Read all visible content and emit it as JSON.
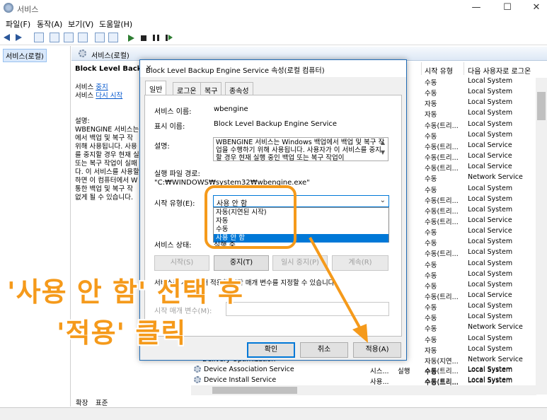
{
  "window": {
    "title": "서비스",
    "minimize": "—",
    "maximize": "☐",
    "close": "✕"
  },
  "menu": [
    "파일(F)",
    "동작(A)",
    "보기(V)",
    "도움말(H)"
  ],
  "left_pane": {
    "item": "서비스(로컬)"
  },
  "content_header": "서비스(로컬)",
  "description": {
    "title": "Block Level Backup",
    "stop_prefix": "서비스 ",
    "stop_link": "중지",
    "restart_prefix": "서비스 ",
    "restart_link": "다시 시작",
    "label": "설명:",
    "lines": [
      "WBENGINE 서비스는 W",
      "에서 백업 및 복구 작",
      "위해 사용됩니다. 사용",
      "를 중지할 경우 현재 실",
      "또는 복구 작업이 실패",
      "다. 이 서비스를 사용할",
      "하면 이 컴퓨터에서 W",
      "통한 백업 및 복구 작",
      "없게 될 수 있습니다."
    ]
  },
  "columns": {
    "startup": "시작 유형",
    "logon": "다음 사용자로 로그온"
  },
  "rows": [
    {
      "startup": "수동",
      "logon": "Local System"
    },
    {
      "startup": "수동",
      "logon": "Local System"
    },
    {
      "startup": "자동",
      "logon": "Local System"
    },
    {
      "startup": "자동",
      "logon": "Local System"
    },
    {
      "startup": "수동(트리...",
      "logon": "Local System"
    },
    {
      "startup": "수동",
      "logon": "Local System"
    },
    {
      "startup": "수동(트리...",
      "logon": "Local Service"
    },
    {
      "startup": "수동(트리...",
      "logon": "Local Service"
    },
    {
      "startup": "수동(트리...",
      "logon": "Local Service"
    },
    {
      "startup": "수동",
      "logon": "Network Service"
    },
    {
      "startup": "수동",
      "logon": "Local System"
    },
    {
      "startup": "수동(트리...",
      "logon": "Local System"
    },
    {
      "startup": "수동(트리...",
      "logon": "Local System"
    },
    {
      "startup": "수동(트리...",
      "logon": "Local Service"
    },
    {
      "startup": "수동",
      "logon": "Local Service"
    },
    {
      "startup": "수동",
      "logon": "Local System"
    },
    {
      "startup": "수동(트리...",
      "logon": "Local System"
    },
    {
      "startup": "수동",
      "logon": "Local System"
    },
    {
      "startup": "수동",
      "logon": "Local System"
    },
    {
      "startup": "수동",
      "logon": "Local System"
    },
    {
      "startup": "수동(트리...",
      "logon": "Local Service"
    },
    {
      "startup": "수동",
      "logon": "Local System"
    },
    {
      "startup": "수동",
      "logon": "Local System"
    },
    {
      "startup": "수동",
      "logon": "Network Service"
    },
    {
      "startup": "수동",
      "logon": "Local System"
    },
    {
      "startup": "자동",
      "logon": "Local System"
    },
    {
      "startup": "자동(지연...",
      "logon": "Network Service"
    },
    {
      "startup": "수동",
      "logon": "Local System"
    },
    {
      "startup": "수동(트리...",
      "logon": "Local System"
    }
  ],
  "bottom_services": [
    {
      "name": "Delivery Optimization",
      "status": "실행",
      "startup": "자동(지연...",
      "logon": "Network Service"
    },
    {
      "name": "Device Association Service",
      "status": "시스...",
      "status2": "실행",
      "startup": "수동(트리...",
      "logon": "Local System"
    },
    {
      "name": "Device Install Service",
      "status": "사용...",
      "startup": "수동(트리...",
      "logon": "Local System"
    }
  ],
  "bottom_tabs": [
    "확장",
    "표준"
  ],
  "dialog": {
    "title": "Block Level Backup Engine Service 속성(로컬 컴퓨터)",
    "close": "✕",
    "tabs": [
      "일반",
      "로그온",
      "복구",
      "종속성"
    ],
    "service_name_label": "서비스 이름:",
    "service_name": "wbengine",
    "display_name_label": "표시 이름:",
    "display_name": "Block Level Backup Engine Service",
    "desc_label": "설명:",
    "desc_text": "WBENGINE 서비스는 Windows 백업에서 백업 및 복구 작업을 수행하기 위해 사용됩니다. 사용자가 이 서비스를 중지할 경우 현재 실행 중인 백업 또는 복구 작업이",
    "exe_label": "실행 파일 경로:",
    "exe_path": "\"C:₩WINDOWS₩system32₩wbengine.exe\"",
    "startup_label": "시작 유형(E):",
    "startup_value": "사용 안 함",
    "options": [
      "자동(지연된 시작)",
      "자동",
      "수동",
      "사용 안 함"
    ],
    "status_label": "서비스 상태:",
    "status_value": "실행 중",
    "btn_start": "시작(S)",
    "btn_stop": "중지(T)",
    "btn_pause": "일시 중지(P)",
    "btn_resume": "계속(R)",
    "hint": "서비스를 시작할 때 적용할 시작 매개 변수를 지정할 수 있습니다.",
    "param_label": "시작 매개 변수(M):",
    "ok": "확인",
    "cancel": "취소",
    "apply": "적용(A)"
  },
  "annotation": {
    "line1": "'사용 안 함' 선택 후",
    "line2": "'적용' 클릭",
    "color": "#f59a1b"
  }
}
